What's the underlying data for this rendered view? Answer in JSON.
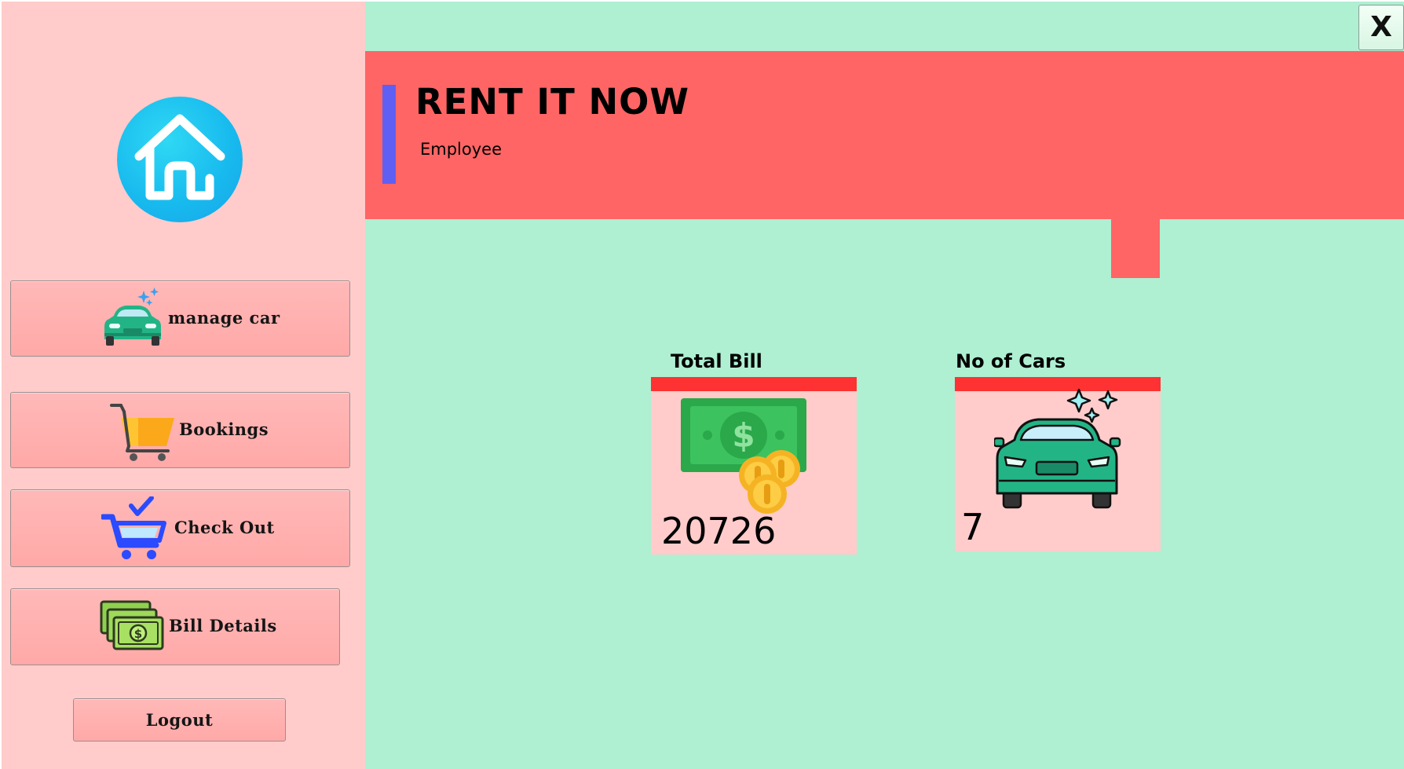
{
  "window": {
    "close_label": "X"
  },
  "sidebar": {
    "logo_icon": "home-icon",
    "buttons": [
      {
        "label": "manage car",
        "icon": "car-icon"
      },
      {
        "label": "Bookings",
        "icon": "shopping-cart-icon"
      },
      {
        "label": "Check Out",
        "icon": "checkout-cart-icon"
      },
      {
        "label": "Bill Details",
        "icon": "cash-stack-icon"
      }
    ],
    "logout_label": "Logout"
  },
  "header": {
    "title": "RENT IT NOW",
    "role": "Employee"
  },
  "stats": {
    "total_bill": {
      "title": "Total Bill",
      "value": "20726",
      "icon": "money-coins-icon"
    },
    "cars": {
      "title": "No of Cars",
      "value": "7",
      "icon": "car-sparkle-icon"
    }
  },
  "colors": {
    "background": "#afefd2",
    "sidebar": "#ffcccb",
    "banner": "#ff6565",
    "banner_accent": "#5f5ff3",
    "card_bar": "#fe3232",
    "button": "#ffa9a8"
  }
}
